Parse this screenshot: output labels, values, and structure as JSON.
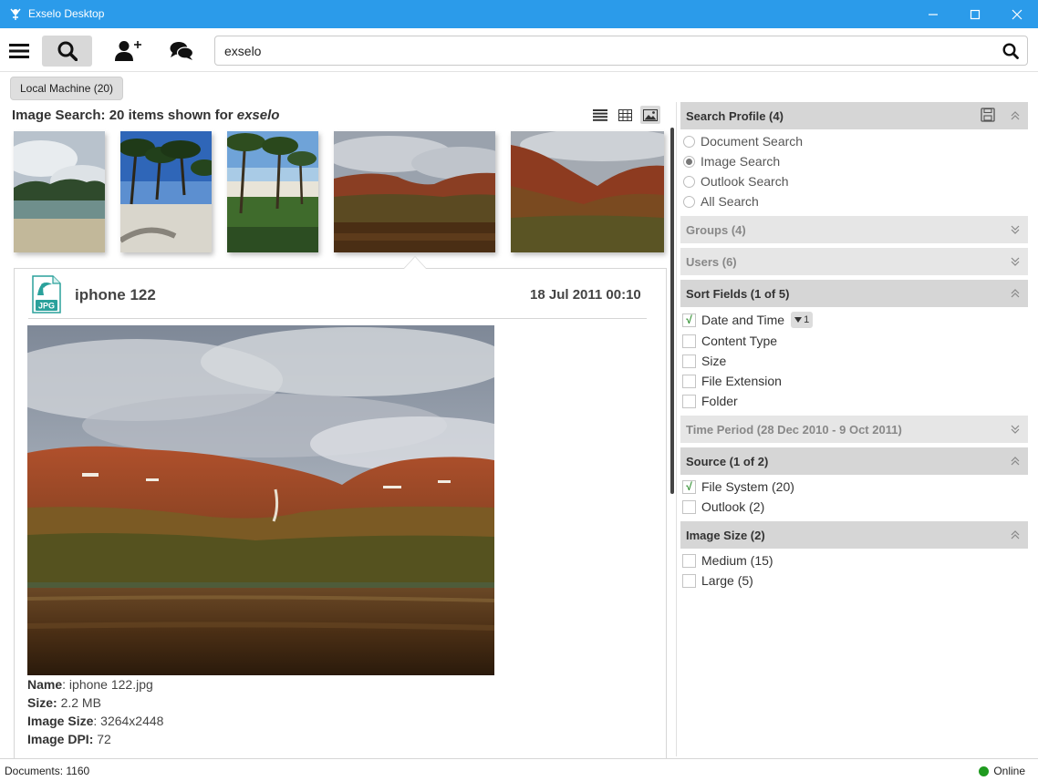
{
  "window": {
    "title": "Exselo Desktop",
    "minimize_icon": "minimize-icon",
    "maximize_icon": "maximize-icon",
    "close_icon": "close-icon"
  },
  "toolbar": {
    "menu_icon": "hamburger-menu-icon",
    "search_icon": "search-icon",
    "add_user_icon": "add-user-icon",
    "chat_icon": "chat-icon",
    "search_value": "exselo"
  },
  "scope_chip": "Local Machine (20)",
  "results": {
    "title_prefix": "Image Search: 20 items shown for ",
    "query": "exselo",
    "views": [
      "list-view-icon",
      "grid-view-icon",
      "image-view-icon"
    ]
  },
  "detail": {
    "file_type": "JPG",
    "name": "iphone 122",
    "date": "18 Jul 2011 00:10",
    "meta": [
      {
        "label": "Name",
        "sep": ": ",
        "value": "iphone 122.jpg"
      },
      {
        "label": "Size:",
        "sep": " ",
        "value": "2.2 MB"
      },
      {
        "label": "Image Size",
        "sep": ": ",
        "value": "3264x2448"
      },
      {
        "label": "Image DPI:",
        "sep": " ",
        "value": "72"
      }
    ]
  },
  "panel": {
    "search_profile": {
      "title": "Search Profile (4)",
      "options": [
        "Document Search",
        "Image Search",
        "Outlook Search",
        "All Search"
      ],
      "selected": "Image Search"
    },
    "groups": {
      "title": "Groups (4)"
    },
    "users": {
      "title": "Users (6)"
    },
    "sort_fields": {
      "title": "Sort Fields (1 of 5)",
      "items": [
        {
          "label": "Date and Time",
          "checked": true,
          "badge": "1"
        },
        {
          "label": "Content Type",
          "checked": false
        },
        {
          "label": "Size",
          "checked": false
        },
        {
          "label": "File Extension",
          "checked": false
        },
        {
          "label": "Folder",
          "checked": false
        }
      ]
    },
    "time_period": {
      "title": "Time Period (28 Dec 2010 - 9 Oct 2011)"
    },
    "source": {
      "title": "Source (1 of 2)",
      "items": [
        {
          "label": "File System (20)",
          "checked": true
        },
        {
          "label": "Outlook (2)",
          "checked": false
        }
      ]
    },
    "image_size": {
      "title": "Image Size (2)",
      "items": [
        {
          "label": "Medium (15)",
          "checked": false
        },
        {
          "label": "Large (5)",
          "checked": false
        }
      ]
    }
  },
  "status": {
    "documents": "Documents: 1160",
    "online": "Online",
    "online_color": "#1f9a1f"
  },
  "colors": {
    "titlebar": "#2b9bea",
    "check_mark": "#2f8f2f"
  }
}
